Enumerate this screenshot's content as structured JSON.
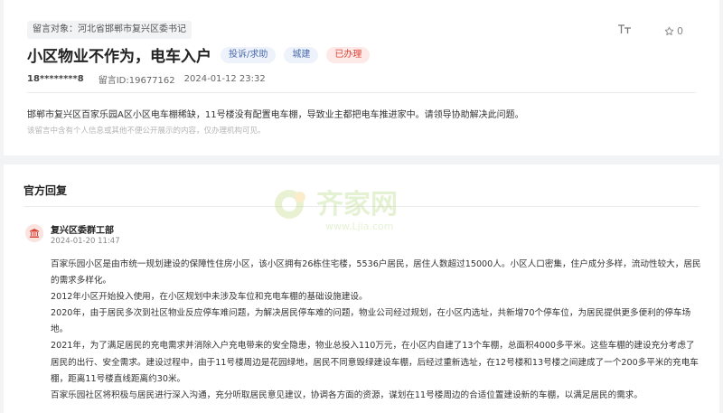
{
  "message": {
    "target_label": "留言对象：河北省邯郸市复兴区委书记",
    "title": "小区物业不作为，电车入户",
    "category_badge": "投诉/求助",
    "department_badge": "城建",
    "status_badge": "已办理",
    "user_phone": "18********8",
    "message_id": "留言ID:19677162",
    "date": "2024-01-12 23:32",
    "content": "邯郸市复兴区百家乐园A区小区电车棚稀缺，11号楼没有配置电车棚，导致业主都把电车推进家中。请领导协助解决此问题。",
    "privacy_note": "该留言中含有个人信息或其他不便公开展示的内容，仅办理机构可见。"
  },
  "toolbar": {
    "font_size_label": "TT",
    "favorite_count": "0",
    "font_size_icon": "text-size-icon",
    "favorite_icon": "star-icon"
  },
  "reply": {
    "heading": "官方回复",
    "org_name": "复兴区委群工部",
    "time": "2024-01-20 11:47",
    "avatar_icon": "government-building-icon",
    "paragraphs": [
      "百家乐园小区是由市统一规划建设的保障性住房小区，该小区拥有26栋住宅楼，5536户居民，居住人数超过15000人。小区人口密集，住户成分多样，流动性较大，居民的需求多样化。",
      "2012年小区开始投入使用，在小区规划中未涉及车位和充电车棚的基础设施建设。",
      "2020年，由于居民多次到社区物业反应停车难问题，为解决居民停车难的问题，物业公司经过规划，在小区内选址，共新增70个停车位，为居民提供更多便利的停车场地。",
      "2021年，为了满足居民的充电需求并消除入户充电带来的安全隐患，物业总投入110万元，在小区内自建了13个车棚，总面积4000多平米。这些车棚的建设充分考虑了居民的出行、安全需求。建设过程中，由于11号楼周边是花园绿地，居民不同意毁绿建设车棚，后经过重新选址，在12号楼和13号楼之间建成了一个200多平米的充电车棚，距离11号楼直线距离约30米。",
      "百家乐园社区将积极与居民进行深入沟通，充分听取居民意见建议，协调各方面的资源，谋划在11号楼周边的合适位置建设新的车棚，以满足居民的需求。"
    ]
  },
  "watermark": {
    "brand": "齐家网",
    "url": "www.Ljia.com"
  },
  "colors": {
    "page_bg": "#f2f3f5",
    "badge_blue_bg": "#eef2fa",
    "badge_blue_text": "#4a6bb0",
    "status_red_bg": "#fde9e7",
    "status_red_text": "#d9453a",
    "avatar_bg": "#fbe3e0",
    "avatar_icon": "#d9453a"
  }
}
